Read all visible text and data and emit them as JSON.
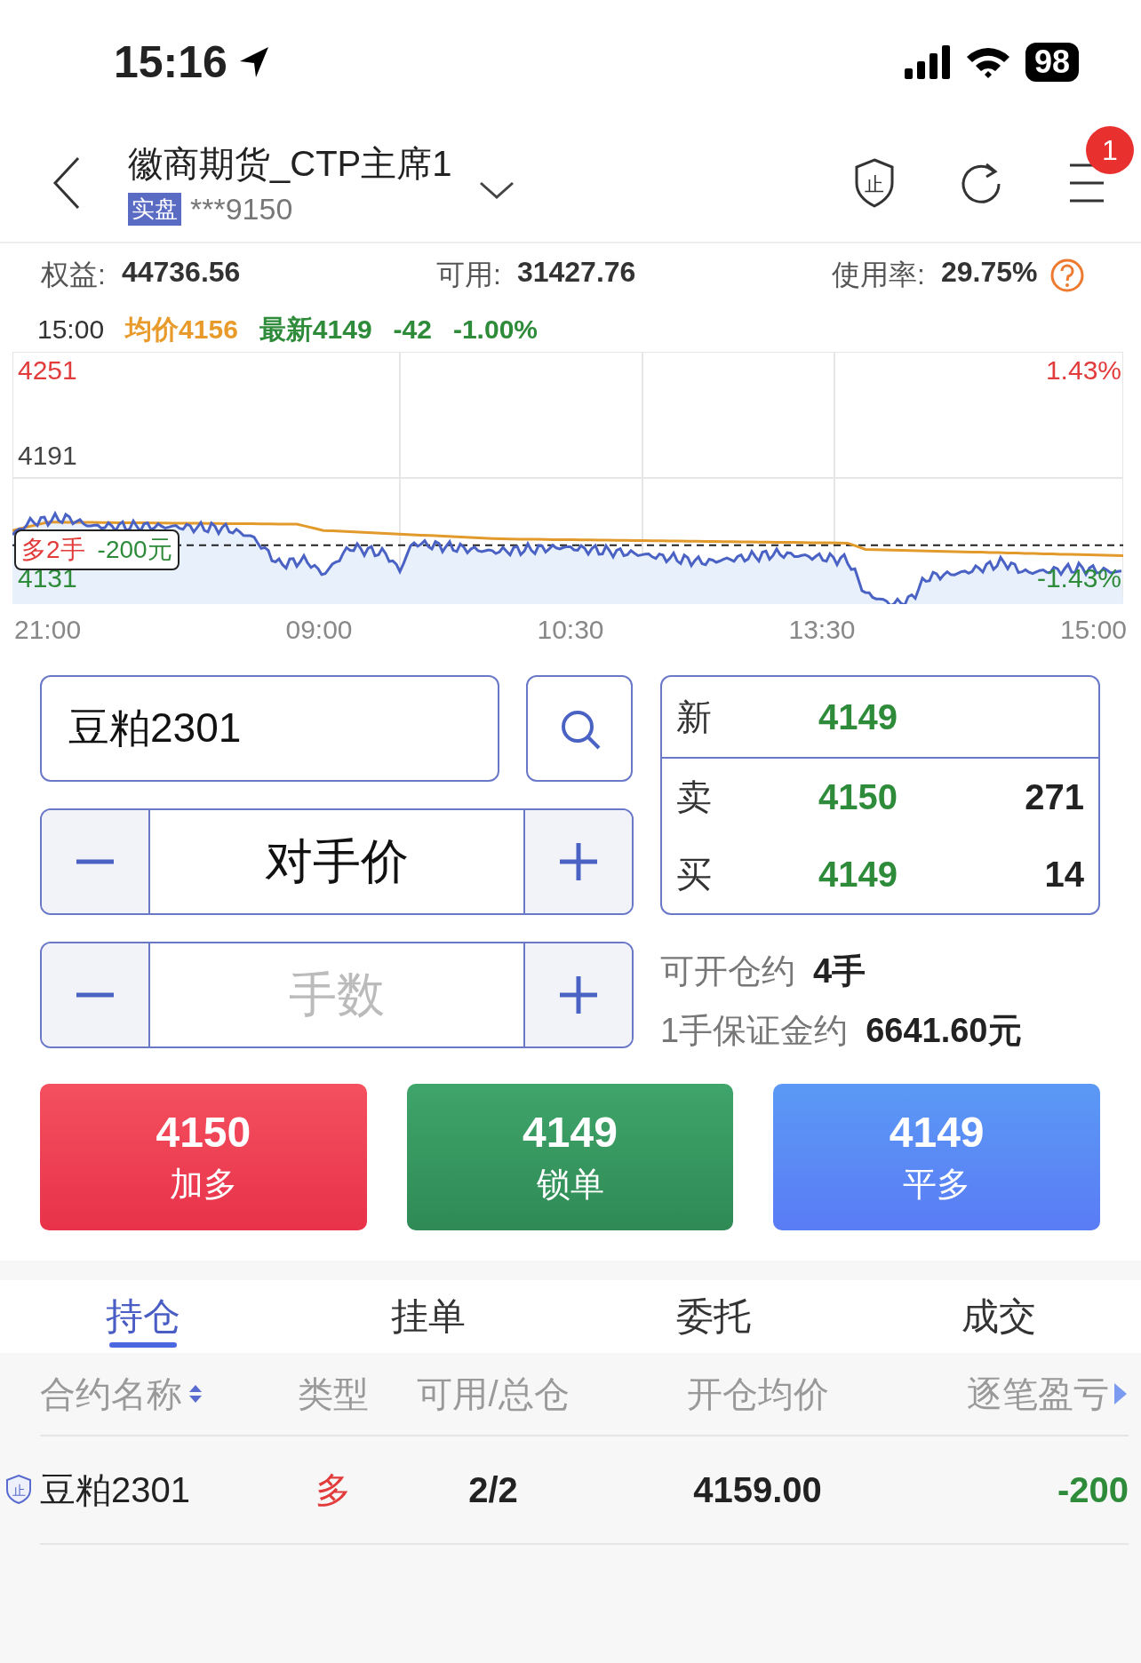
{
  "status_bar": {
    "time": "15:16",
    "battery": "98"
  },
  "header": {
    "title": "徽商期货_CTP主席1",
    "tag": "实盘",
    "account": "***9150",
    "shield_glyph": "止",
    "badge": "1"
  },
  "account": [
    {
      "label": "权益:",
      "value": "44736.56"
    },
    {
      "label": "可用:",
      "value": "31427.76"
    },
    {
      "label": "使用率:",
      "value": "29.75%"
    }
  ],
  "chart": {
    "info": [
      {
        "text": "15:00",
        "kind": "time"
      },
      {
        "text": "均价4156",
        "kind": "avg"
      },
      {
        "text": "最新4149",
        "kind": "down"
      },
      {
        "text": "-42",
        "kind": "down"
      },
      {
        "text": "-1.00%",
        "kind": "down"
      }
    ],
    "y_labels": [
      {
        "text": "4251",
        "kind": "up"
      },
      {
        "text": "4191",
        "kind": "flat"
      },
      {
        "text": "4131",
        "kind": "down"
      }
    ],
    "pct_labels": [
      {
        "text": "1.43%",
        "kind": "up"
      },
      {
        "text": "-1.43%",
        "kind": "down"
      }
    ],
    "x_labels": [
      "21:00",
      "09:00",
      "10:30",
      "13:30",
      "15:00"
    ],
    "position_tag": {
      "side": "多2手",
      "pnl": "-200元"
    }
  },
  "order": {
    "contract": "豆粕2301",
    "price_mode": "对手价",
    "lots_placeholder": "手数"
  },
  "quote": [
    {
      "label": "新",
      "price": "4149"
    },
    {
      "label": "卖",
      "price": "4150",
      "volume": "271"
    },
    {
      "label": "买",
      "price": "4149",
      "volume": "14"
    }
  ],
  "capacity": [
    {
      "label": "可开仓约",
      "value": "4手"
    },
    {
      "label": "1手保证金约",
      "value": "6641.60元"
    }
  ],
  "actions": [
    {
      "price": "4150",
      "label": "加多",
      "kind": "buy"
    },
    {
      "price": "4149",
      "label": "锁单",
      "kind": "lock"
    },
    {
      "price": "4149",
      "label": "平多",
      "kind": "close"
    }
  ],
  "tabs": [
    {
      "label": "持仓",
      "selected": true
    },
    {
      "label": "挂单",
      "selected": false
    },
    {
      "label": "委托",
      "selected": false
    },
    {
      "label": "成交",
      "selected": false
    }
  ],
  "table": {
    "columns": [
      {
        "label": "合约名称",
        "kind": "sort"
      },
      {
        "label": "类型",
        "kind": "plain"
      },
      {
        "label": "可用/总仓",
        "kind": "plain"
      },
      {
        "label": "开仓均价",
        "kind": "plain"
      },
      {
        "label": "逐笔盈亏",
        "kind": "more"
      }
    ],
    "rows": [
      {
        "badge": "止",
        "cells": [
          {
            "text": "豆粕2301",
            "kind": "plain"
          },
          {
            "text": "多",
            "kind": "up"
          },
          {
            "text": "2/2",
            "kind": "bold"
          },
          {
            "text": "4159.00",
            "kind": "bold"
          },
          {
            "text": "-200",
            "kind": "down"
          }
        ]
      }
    ]
  }
}
